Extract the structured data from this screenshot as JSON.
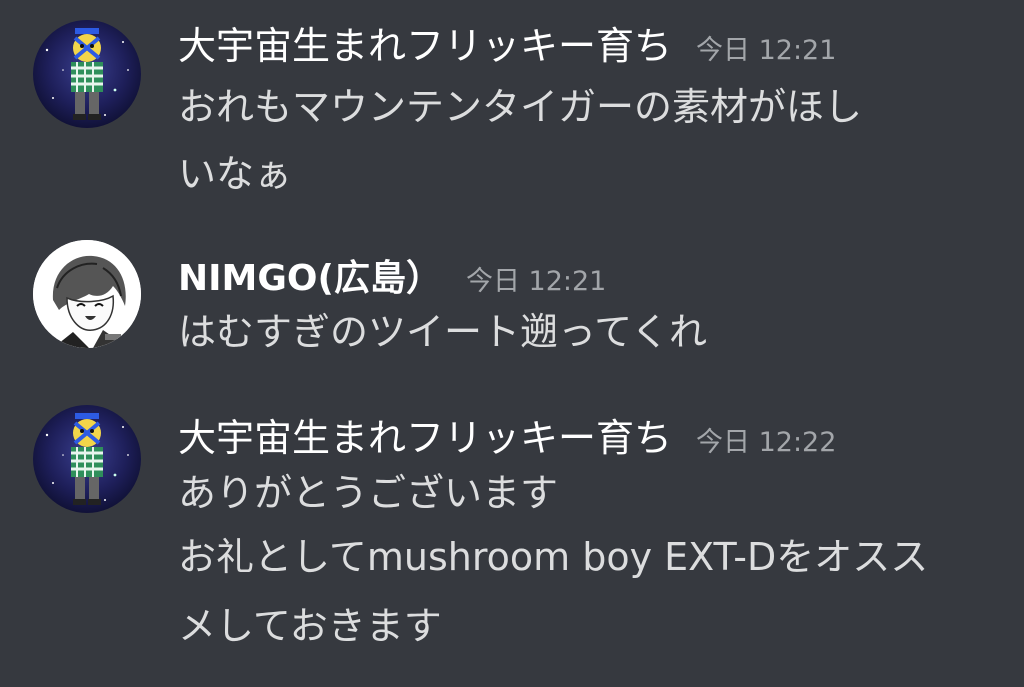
{
  "messages": [
    {
      "author": "大宇宙生まれフリッキー育ち",
      "timestamp": "今日 12:21",
      "lines": [
        "おれもマウンテンタイガーの素材がほし",
        "いなぁ"
      ]
    },
    {
      "author": "NIMGO(広島）",
      "timestamp": "今日 12:21",
      "lines": [
        "はむすぎのツイート遡ってくれ"
      ]
    },
    {
      "author": "大宇宙生まれフリッキー育ち",
      "timestamp": "今日 12:22",
      "lines": [
        "ありがとうございます",
        "お礼としてmushroom boy EXT-Dをオスス",
        "メしておきます"
      ]
    }
  ],
  "colors": {
    "background": "#36393f",
    "username": "#ffffff",
    "message_text": "#dcddde",
    "timestamp": "#a3a6aa"
  },
  "icons": {
    "avatar_1": "galaxy-character-avatar-icon",
    "avatar_2": "anime-boy-avatar-icon",
    "avatar_3": "galaxy-character-avatar-icon"
  }
}
